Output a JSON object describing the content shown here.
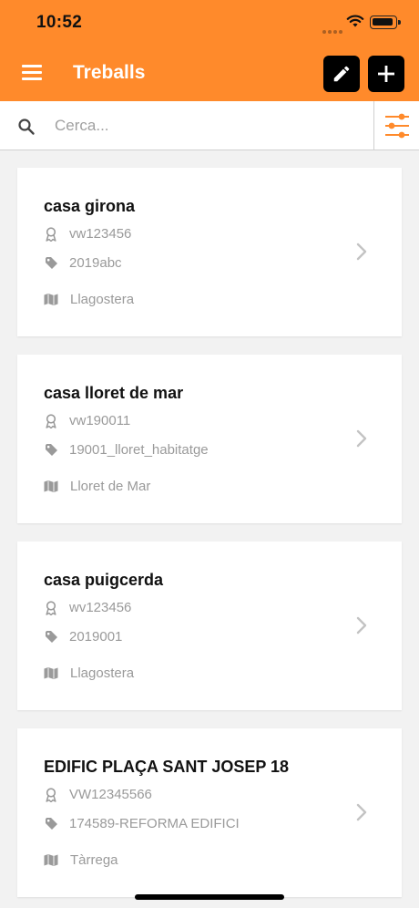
{
  "status_bar": {
    "time": "10:52"
  },
  "header": {
    "title": "Treballs"
  },
  "search": {
    "placeholder": "Cerca..."
  },
  "jobs": [
    {
      "title": "casa girona",
      "code": "vw123456",
      "tag": "2019abc",
      "location": "Llagostera"
    },
    {
      "title": "casa lloret de mar",
      "code": "vw190011",
      "tag": "19001_lloret_habitatge",
      "location": "Lloret de Mar"
    },
    {
      "title": "casa puigcerda",
      "code": "wv123456",
      "tag": "2019001",
      "location": "Llagostera"
    },
    {
      "title": "EDIFIC PLAÇA SANT JOSEP 18",
      "code": "VW12345566",
      "tag": "174589-REFORMA EDIFICI",
      "location": "Tàrrega"
    }
  ],
  "icons": {
    "menu": "hamburger-icon",
    "edit": "pencil-icon",
    "add": "plus-icon",
    "search": "search-icon",
    "filter": "sliders-icon",
    "code": "award-icon",
    "tag": "tag-icon",
    "location": "map-icon",
    "open": "chevron-right-icon"
  },
  "colors": {
    "accent": "#ff8a2b",
    "button": "#000000",
    "muted_text": "#9a9a9a"
  }
}
